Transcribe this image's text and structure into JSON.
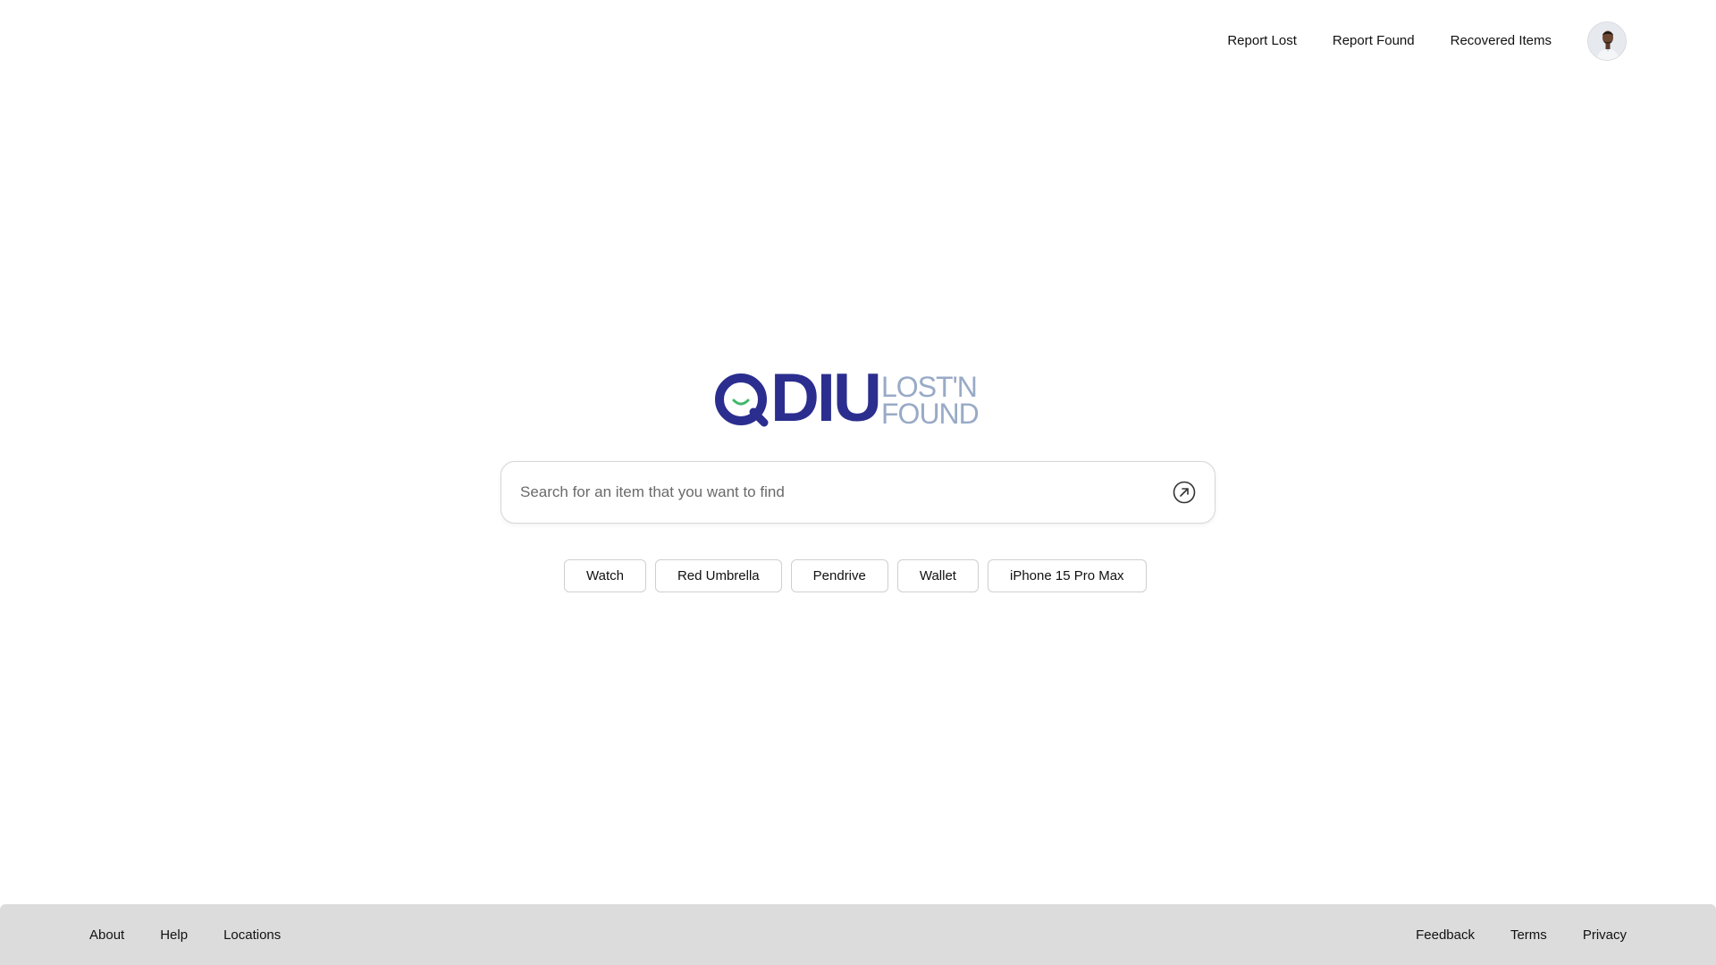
{
  "nav": {
    "links": [
      "Report Lost",
      "Report Found",
      "Recovered Items"
    ],
    "avatar_icon": "user-avatar"
  },
  "logo": {
    "main": "DIU",
    "sub_line1": "LOST'N",
    "sub_line2": "FOUND",
    "icon": "search-smile-icon",
    "colors": {
      "primary": "#2b2e8e",
      "secondary": "#98aac6",
      "accent": "#3fb86a"
    }
  },
  "search": {
    "placeholder": "Search for an item that you want to find",
    "value": "",
    "submit_icon": "arrow-up-right-circle-icon"
  },
  "suggestions": [
    "Watch",
    "Red Umbrella",
    "Pendrive",
    "Wallet",
    "iPhone 15 Pro Max"
  ],
  "footer": {
    "left": [
      "About",
      "Help",
      "Locations"
    ],
    "right": [
      "Feedback",
      "Terms",
      "Privacy"
    ]
  }
}
